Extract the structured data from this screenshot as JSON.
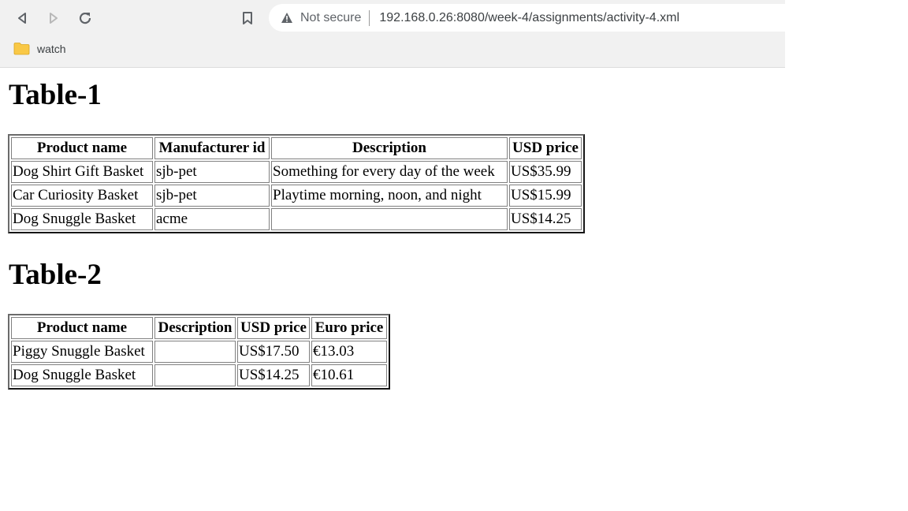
{
  "browser": {
    "security_label": "Not secure",
    "url": "192.168.0.26:8080/week-4/assignments/activity-4.xml",
    "bookmarks": [
      {
        "label": "watch",
        "icon": "folder-icon"
      }
    ]
  },
  "page": {
    "table1": {
      "title": "Table-1",
      "headers": [
        "Product name",
        "Manufacturer id",
        "Description",
        "USD price"
      ],
      "rows": [
        [
          "Dog Shirt Gift Basket",
          "sjb-pet",
          "Something for every day of the week",
          "US$35.99"
        ],
        [
          "Car Curiosity Basket",
          "sjb-pet",
          "Playtime morning, noon, and night",
          "US$15.99"
        ],
        [
          "Dog Snuggle Basket",
          "acme",
          "",
          "US$14.25"
        ]
      ]
    },
    "table2": {
      "title": "Table-2",
      "headers": [
        "Product name",
        "Description",
        "USD price",
        "Euro price"
      ],
      "rows": [
        [
          "Piggy Snuggle Basket",
          "",
          "US$17.50",
          "€13.03"
        ],
        [
          "Dog Snuggle Basket",
          "",
          "US$14.25",
          "€10.61"
        ]
      ]
    }
  },
  "colors": {
    "chrome_bg": "#f1f1f1",
    "folder": "#f9c846"
  }
}
